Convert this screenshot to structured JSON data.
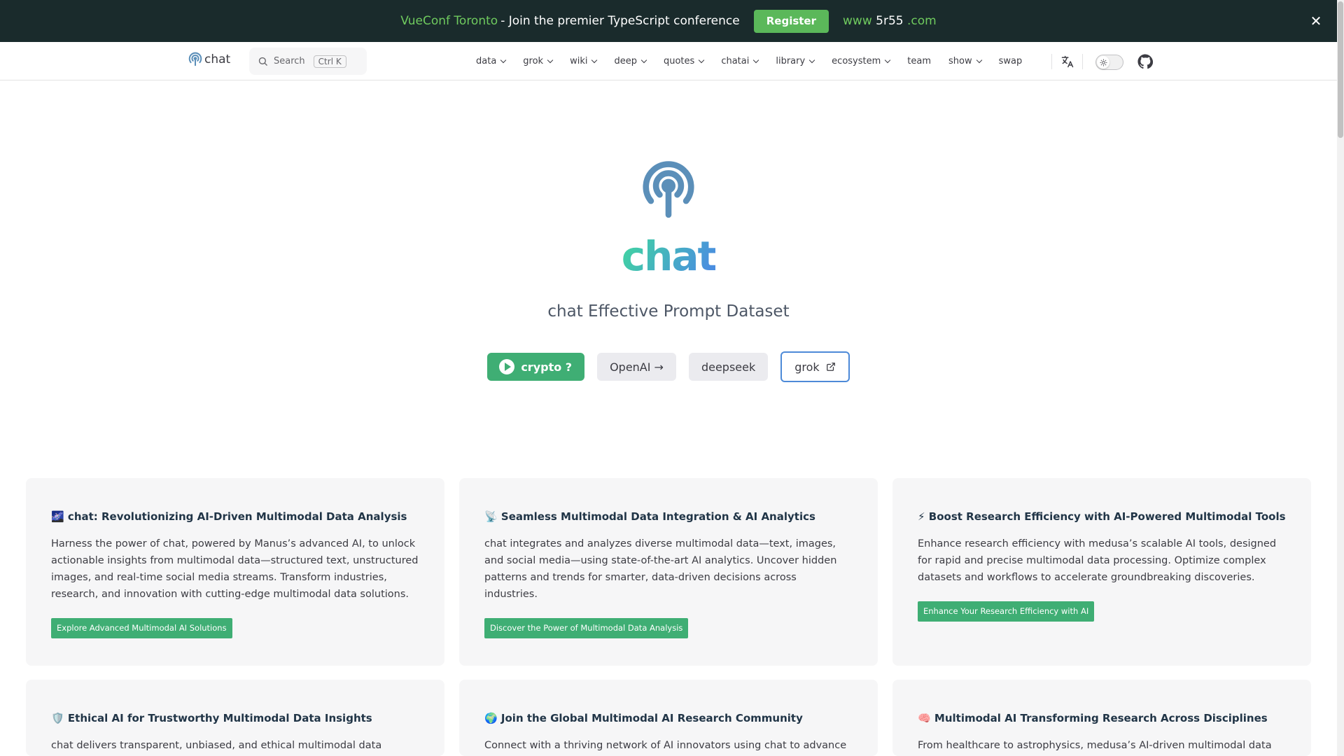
{
  "banner": {
    "conf": "VueConf Toronto",
    "text": "- Join the premier TypeScript conference",
    "register": "Register",
    "www_prefix": "www",
    "www_middle": "5r55",
    "www_suffix": ".com",
    "close": "✕"
  },
  "nav": {
    "logo_text": "chat",
    "search_label": "Search",
    "search_kbd": "Ctrl K",
    "items": [
      {
        "label": "data",
        "dropdown": true
      },
      {
        "label": "grok",
        "dropdown": true
      },
      {
        "label": "wiki",
        "dropdown": true
      },
      {
        "label": "deep",
        "dropdown": true
      },
      {
        "label": "quotes",
        "dropdown": true
      },
      {
        "label": "chatai",
        "dropdown": true
      },
      {
        "label": "library",
        "dropdown": true
      },
      {
        "label": "ecosystem",
        "dropdown": true
      },
      {
        "label": "team",
        "dropdown": false
      },
      {
        "label": "show",
        "dropdown": true
      },
      {
        "label": "swap",
        "dropdown": false
      }
    ],
    "icons": [
      "translate-icon",
      "sun-icon",
      "github-icon"
    ]
  },
  "hero": {
    "title": "chat",
    "subtitle": "chat Effective Prompt Dataset",
    "actions": [
      {
        "label": "crypto ?",
        "style": "brand"
      },
      {
        "label": "OpenAI →",
        "style": "alt"
      },
      {
        "label": "deepseek",
        "style": "alt"
      },
      {
        "label": "grok",
        "style": "outline"
      }
    ]
  },
  "features": [
    {
      "emoji": "🌌",
      "title": "chat: Revolutionizing AI-Driven Multimodal Data Analysis",
      "text": "Harness the power of chat, powered by Manus’s advanced AI, to unlock actionable insights from multimodal data—structured text, unstructured images, and real-time social media streams. Transform industries, research, and innovation with cutting-edge multimodal data solutions.",
      "button": "Explore Advanced Multimodal AI Solutions"
    },
    {
      "emoji": "📡",
      "title": "Seamless Multimodal Data Integration & AI Analytics",
      "text": "chat integrates and analyzes diverse multimodal data—text, images, and social media—using state-of-the-art AI analytics. Uncover hidden patterns and trends for smarter, data-driven decisions across industries.",
      "button": "Discover the Power of Multimodal Data Analysis"
    },
    {
      "emoji": "⚡",
      "title": "Boost Research Efficiency with AI-Powered Multimodal Tools",
      "text": "Enhance research efficiency with medusa’s scalable AI tools, designed for rapid and precise multimodal data processing. Optimize complex datasets and workflows to accelerate groundbreaking discoveries.",
      "button": "Enhance Your Research Efficiency with AI"
    },
    {
      "emoji": "🛡️",
      "title": "Ethical AI for Trustworthy Multimodal Data Insights",
      "text": "chat delivers transparent, unbiased, and ethical multimodal data analysis.",
      "button": ""
    },
    {
      "emoji": "🌍",
      "title": "Join the Global Multimodal AI Research Community",
      "text": "Connect with a thriving network of AI innovators using chat to advance",
      "button": ""
    },
    {
      "emoji": "🧠",
      "title": "Multimodal AI Transforming Research Across Disciplines",
      "text": "From healthcare to astrophysics, medusa’s AI-driven multimodal data",
      "button": ""
    }
  ],
  "colors": {
    "brand": "#3fae74",
    "banner_bg": "#1a2b2c",
    "banner_accent": "#6fca5e",
    "title_gradient_start": "#41d1a4",
    "title_gradient_end": "#4a8ee0",
    "hero_icon": "#5b8fb9"
  }
}
